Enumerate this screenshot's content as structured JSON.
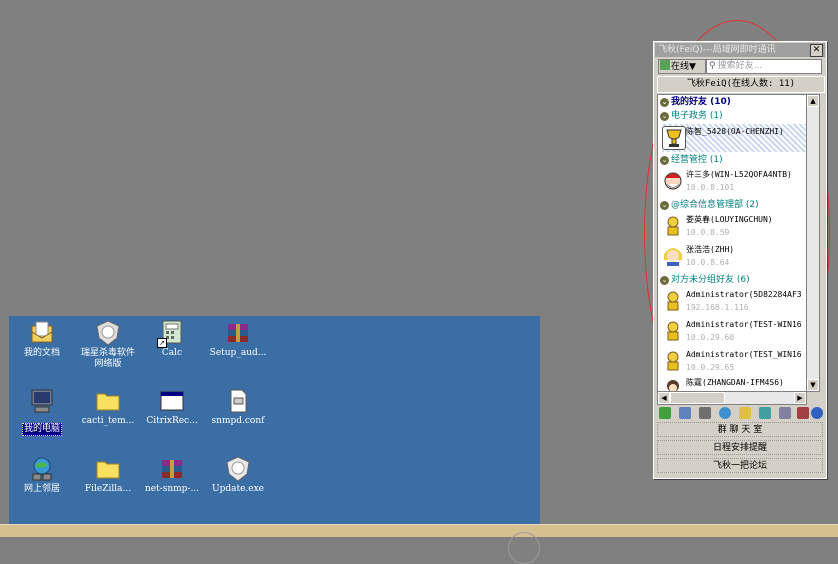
{
  "desktop": {
    "icons": [
      {
        "label": "我的文档",
        "icon": "my-documents-icon"
      },
      {
        "label": "瑞星杀毒软件\n网络版",
        "icon": "rising-antivirus-icon"
      },
      {
        "label": "Calc",
        "icon": "calc-icon"
      },
      {
        "label": "Setup_aud...",
        "icon": "winrar-icon"
      },
      {
        "label": "我的电脑",
        "icon": "my-computer-icon"
      },
      {
        "label": "cacti_tem...",
        "icon": "folder-icon"
      },
      {
        "label": "CitrixRec...",
        "icon": "window-icon"
      },
      {
        "label": "snmpd.conf",
        "icon": "config-file-icon"
      },
      {
        "label": "网上邻居",
        "icon": "network-places-icon"
      },
      {
        "label": "FileZilla...",
        "icon": "folder-icon"
      },
      {
        "label": "net-snmp-...",
        "icon": "winrar-icon"
      },
      {
        "label": "Update.exe",
        "icon": "rising-update-icon"
      }
    ]
  },
  "feiq": {
    "title": "飞秋(FeiQ)---局域网即时通讯",
    "close_label": "✕",
    "status_label": "在线▼",
    "search_placeholder": "搜索好友...",
    "online_banner": "飞秋FeiQ(在线人数: 11)",
    "groups": {
      "my_friends": "我的好友 (10)",
      "ediplomacy": "电子政务 (1)",
      "operations": "经营管控 (1)",
      "info_dept": "@综合信息管理部 (2)",
      "ungrouped": "对方未分组好友 (6)"
    },
    "friends": [
      {
        "name": "陈智_5428(OA-CHENZHI)",
        "ip": ""
      },
      {
        "name": "许三多(WIN-L52QOFA4NTB)",
        "ip": "10.0.8.101"
      },
      {
        "name": "娄英春(LOUYINGCHUN)",
        "ip": "10.0.8.59"
      },
      {
        "name": "张浩浩(ZHH)",
        "ip": "10.0.8.64"
      },
      {
        "name": "Administrator(5D82284AF3",
        "ip": "192.168.1.116"
      },
      {
        "name": "Administrator(TEST-WIN16",
        "ip": "10.0.29.60"
      },
      {
        "name": "Administrator(TEST_WIN16",
        "ip": "10.0.29.65"
      },
      {
        "name": "陈霆(ZHANGDAN-IFM4S6)",
        "ip": ""
      }
    ],
    "buttons": {
      "group_chat": "群 聊 天 室",
      "schedule": "日程安排提醒",
      "forum": "飞秋一把论坛"
    }
  }
}
